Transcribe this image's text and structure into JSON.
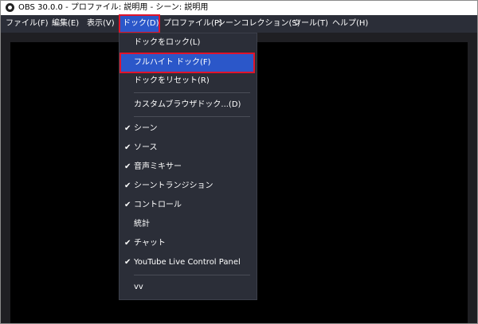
{
  "window": {
    "title": "OBS 30.0.0 - プロファイル: 説明用 - シーン: 説明用"
  },
  "menubar": {
    "items": [
      {
        "label": "ファイル(F)"
      },
      {
        "label": "編集(E)"
      },
      {
        "label": "表示(V)"
      },
      {
        "label": "ドック(D)"
      },
      {
        "label": "プロファイル(P)"
      },
      {
        "label": "シーンコレクション(S)"
      },
      {
        "label": "ツール(T)"
      },
      {
        "label": "ヘルプ(H)"
      }
    ],
    "active_item": "ドック(D)"
  },
  "dock_menu": {
    "items": [
      {
        "label": "ドックをロック(L)",
        "checked": false
      },
      {
        "label": "フルハイト ドック(F)",
        "checked": false,
        "highlighted": true
      },
      {
        "label": "ドックをリセット(R)",
        "checked": false
      },
      {
        "label": "カスタムブラウザドック...(D)",
        "checked": false
      },
      {
        "label": "シーン",
        "checked": true
      },
      {
        "label": "ソース",
        "checked": true
      },
      {
        "label": "音声ミキサー",
        "checked": true
      },
      {
        "label": "シーントランジション",
        "checked": true
      },
      {
        "label": "コントロール",
        "checked": true
      },
      {
        "label": "統計",
        "checked": false
      },
      {
        "label": "チャット",
        "checked": true
      },
      {
        "label": "YouTube Live Control Panel",
        "checked": true
      },
      {
        "label": "vv",
        "checked": false
      }
    ],
    "check_glyph": "✔"
  },
  "colors": {
    "menu_bg": "#2b2e38",
    "highlight_bg": "#2b57c9",
    "annotation_red": "#e0142b",
    "canvas_bg": "#000000"
  }
}
